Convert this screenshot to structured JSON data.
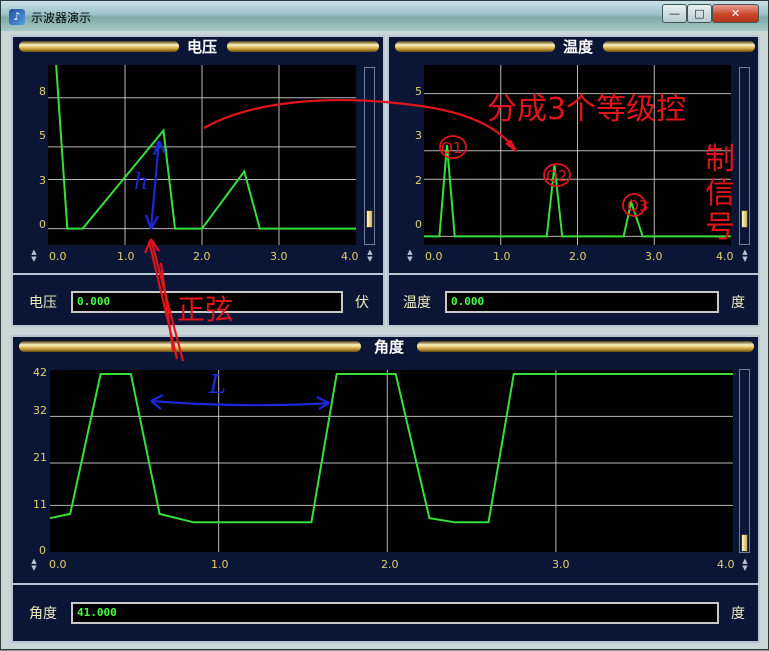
{
  "window": {
    "title": "示波器演示",
    "icon": "app-logo-icon",
    "min": "—",
    "max": "□",
    "close": "✕"
  },
  "voltage": {
    "title": "电压",
    "y_ticks": [
      "8",
      "5",
      "3",
      "0"
    ],
    "x_ticks": [
      "0.0",
      "1.0",
      "2.0",
      "3.0",
      "4.0"
    ],
    "readout_label": "电压",
    "readout_value": "0.000",
    "unit": "伏"
  },
  "temperature": {
    "title": "温度",
    "y_ticks": [
      "5",
      "3",
      "2",
      "0"
    ],
    "x_ticks": [
      "0.0",
      "1.0",
      "2.0",
      "3.0",
      "4.0"
    ],
    "readout_label": "温度",
    "readout_value": "0.000",
    "unit": "度"
  },
  "angle": {
    "title": "角度",
    "y_ticks": [
      "42",
      "32",
      "21",
      "11",
      "0"
    ],
    "x_ticks": [
      "0.0",
      "1.0",
      "2.0",
      "3.0",
      "4.0"
    ],
    "readout_label": "角度",
    "readout_value": "41.000",
    "unit": "度"
  },
  "annotations": {
    "zheng_xian": "正弦",
    "h": "h",
    "l": "L",
    "levels_note": "分成3个等级控制信号",
    "q1": "Q1",
    "q2": "Q2",
    "q3": "Q3"
  },
  "colors": {
    "trace": "#36e03a",
    "grid": "#d8d8d8",
    "tick": "#e3d06b",
    "panel": "#0b1636",
    "red_ink": "#e0141a",
    "blue_ink": "#1c28d6"
  },
  "chart_data": [
    {
      "type": "line",
      "title": "电压",
      "xlim": [
        0,
        4
      ],
      "ylim": [
        -1,
        10
      ],
      "grid": true,
      "series": [
        {
          "x": [
            0.1,
            0.25,
            0.45,
            1.5,
            1.65,
            2.0,
            2.55,
            2.75,
            4.0
          ],
          "y": [
            10.4,
            0,
            0,
            6,
            0,
            0,
            3.5,
            0,
            0
          ]
        }
      ]
    },
    {
      "type": "line",
      "title": "温度",
      "xlim": [
        0,
        4
      ],
      "ylim": [
        -0.3,
        6
      ],
      "grid": true,
      "series": [
        {
          "x": [
            0.0,
            0.2,
            0.3,
            0.4,
            1.6,
            1.7,
            1.8,
            2.6,
            2.7,
            2.85,
            4.0
          ],
          "y": [
            0,
            0,
            3.2,
            0,
            0,
            2.5,
            0,
            0,
            1.2,
            0,
            0
          ]
        }
      ]
    },
    {
      "type": "line",
      "title": "角度",
      "xlim": [
        0,
        4.05
      ],
      "ylim": [
        0,
        42
      ],
      "grid": true,
      "series": [
        {
          "x": [
            0.0,
            0.12,
            0.3,
            0.48,
            0.65,
            0.85,
            1.55,
            1.7,
            2.05,
            2.25,
            2.4,
            2.6,
            2.75,
            3.2,
            4.05
          ],
          "y": [
            8,
            9,
            42,
            42,
            9,
            7,
            7,
            42,
            42,
            8,
            7,
            7,
            42,
            42,
            42
          ]
        }
      ]
    }
  ]
}
